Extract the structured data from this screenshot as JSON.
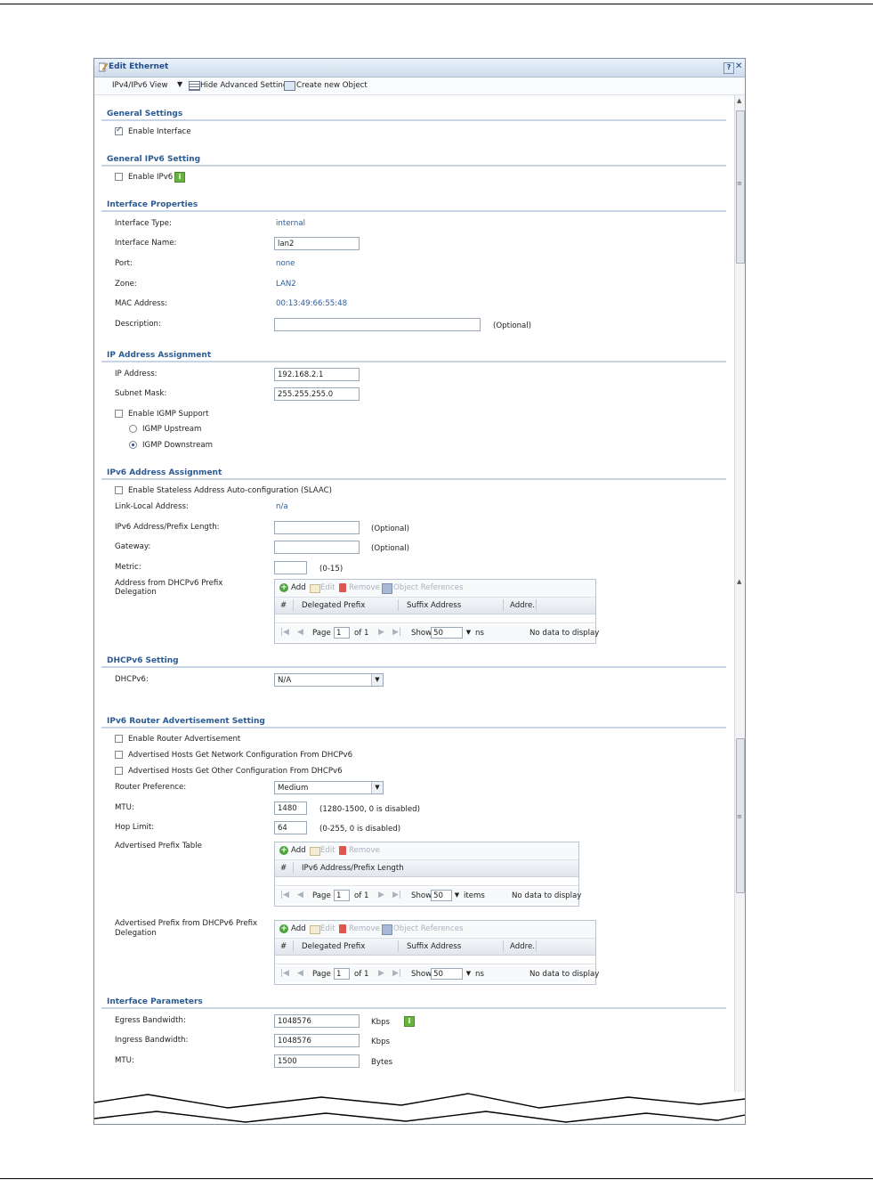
{
  "window": {
    "title": "Edit Ethernet"
  },
  "toolbar": {
    "view": "IPv4/IPv6 View",
    "hide_advanced": "Hide Advanced Settings",
    "create_object": "Create new Object"
  },
  "general": {
    "heading": "General Settings",
    "enable_interface": "Enable Interface"
  },
  "ipv6_setting": {
    "heading": "General IPv6 Setting",
    "enable_ipv6": "Enable IPv6"
  },
  "props": {
    "heading": "Interface Properties",
    "type_label": "Interface Type:",
    "type_value": "internal",
    "name_label": "Interface Name:",
    "name_value": "lan2",
    "port_label": "Port:",
    "port_value": "none",
    "zone_label": "Zone:",
    "zone_value": "LAN2",
    "mac_label": "MAC Address:",
    "mac_value": "00:13:49:66:55:48",
    "desc_label": "Description:",
    "desc_value": "",
    "desc_hint": "(Optional)"
  },
  "ip": {
    "heading": "IP Address Assignment",
    "ip_label": "IP Address:",
    "ip_value": "192.168.2.1",
    "mask_label": "Subnet Mask:",
    "mask_value": "255.255.255.0",
    "igmp_label": "Enable IGMP Support",
    "igmp_up": "IGMP Upstream",
    "igmp_down": "IGMP Downstream"
  },
  "ipv6": {
    "heading": "IPv6 Address Assignment",
    "slaac": "Enable Stateless Address Auto-configuration (SLAAC)",
    "link_local_label": "Link-Local Address:",
    "link_local_value": "n/a",
    "prefix_label": "IPv6 Address/Prefix Length:",
    "prefix_hint": "(Optional)",
    "gateway_label": "Gateway:",
    "gateway_hint": "(Optional)",
    "metric_label": "Metric:",
    "metric_hint": "(0-15)",
    "dhcp_prefix_label_1": "Address from DHCPv6 Prefix",
    "dhcp_prefix_label_2": "Delegation"
  },
  "grid1": {
    "add": "Add",
    "edit": "Edit",
    "remove": "Remove",
    "refs": "Object References",
    "cols": [
      "#",
      "Delegated Prefix",
      "Suffix Address",
      "Addre.."
    ],
    "page": "Page",
    "page_num": "1",
    "of": "of 1",
    "show": "Show",
    "show_num": "50",
    "items": "ns",
    "empty": "No data to display"
  },
  "dhcpv6": {
    "heading": "DHCPv6 Setting",
    "label": "DHCPv6:",
    "value": "N/A"
  },
  "ra": {
    "heading": "IPv6 Router Advertisement Setting",
    "enable_ra": "Enable Router Advertisement",
    "net_config": "Advertised Hosts Get Network Configuration From DHCPv6",
    "other_config": "Advertised Hosts Get Other Configuration From DHCPv6",
    "pref_label": "Router Preference:",
    "pref_value": "Medium",
    "mtu_label": "MTU:",
    "mtu_value": "1480",
    "mtu_hint": "(1280-1500, 0 is disabled)",
    "hop_label": "Hop Limit:",
    "hop_value": "64",
    "hop_hint": "(0-255, 0 is disabled)",
    "table_label": "Advertised Prefix Table",
    "dhcp_label_1": "Advertised Prefix from DHCPv6 Prefix",
    "dhcp_label_2": "Delegation"
  },
  "grid2": {
    "add": "Add",
    "edit": "Edit",
    "remove": "Remove",
    "cols": [
      "#",
      "IPv6 Address/Prefix Length"
    ],
    "page": "Page",
    "page_num": "1",
    "of": "of 1",
    "show": "Show",
    "show_num": "50",
    "items": "items",
    "empty": "No data to display"
  },
  "grid3": {
    "add": "Add",
    "edit": "Edit",
    "remove": "Remove",
    "refs": "Object References",
    "cols": [
      "#",
      "Delegated Prefix",
      "Suffix Address",
      "Addre.."
    ],
    "page": "Page",
    "page_num": "1",
    "of": "of 1",
    "show": "Show",
    "show_num": "50",
    "items": "ns",
    "empty": "No data to display"
  },
  "params": {
    "heading": "Interface Parameters",
    "egress_label": "Egress Bandwidth:",
    "egress_value": "1048576",
    "egress_unit": "Kbps",
    "ingress_label": "Ingress Bandwidth:",
    "ingress_value": "1048576",
    "ingress_unit": "Kbps",
    "mtu_label": "MTU:",
    "mtu_value": "1500",
    "mtu_unit": "Bytes"
  },
  "icons": {
    "info": "i",
    "help": "?",
    "close": "✕"
  },
  "colors": {
    "section": "#2b5a93",
    "link_value": "#2d5d9a",
    "info_green": "#68b33e"
  }
}
